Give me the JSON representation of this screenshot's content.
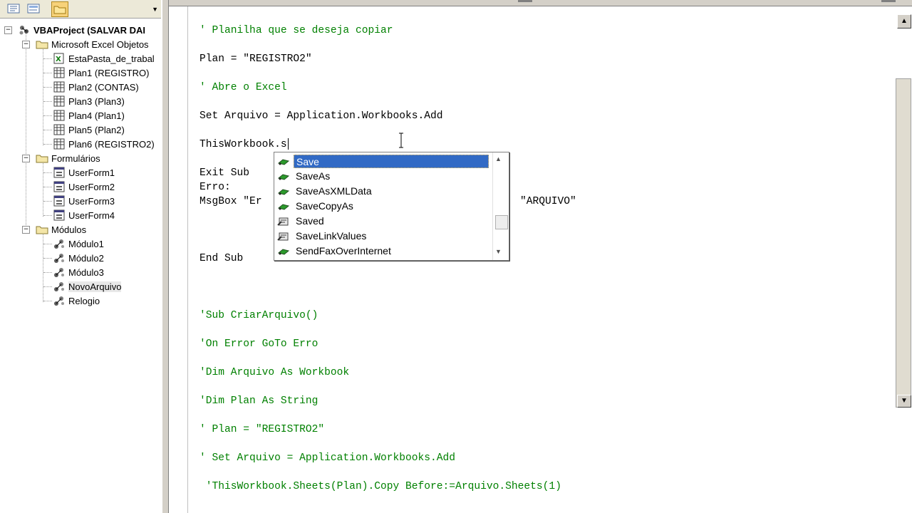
{
  "explorer": {
    "toolbar": {
      "view_code_icon": "view-code-icon",
      "view_object_icon": "view-object-icon",
      "toggle_folders_icon": "folder-icon",
      "dropdown_glyph": "▼"
    },
    "tree": {
      "root": {
        "label": "VBAProject (SALVAR DAI",
        "toggle": "−"
      },
      "groups": [
        {
          "label": "Microsoft Excel Objetos",
          "toggle": "−",
          "items": [
            "EstaPasta_de_trabal",
            "Plan1 (REGISTRO)",
            "Plan2 (CONTAS)",
            "Plan3 (Plan3)",
            "Plan4 (Plan1)",
            "Plan5 (Plan2)",
            "Plan6 (REGISTRO2)"
          ]
        },
        {
          "label": "Formulários",
          "toggle": "−",
          "items": [
            "UserForm1",
            "UserForm2",
            "UserForm3",
            "UserForm4"
          ]
        },
        {
          "label": "Módulos",
          "toggle": "−",
          "items": [
            "Módulo1",
            "Módulo2",
            "Módulo3",
            "NovoArquivo",
            "Relogio"
          ]
        }
      ],
      "selected_item": "NovoArquivo"
    }
  },
  "code": {
    "lines": [
      {
        "text": "' Planilha que se deseja copiar",
        "style": "comment"
      },
      {
        "text": "Plan = \"REGISTRO2\"",
        "style": "code"
      },
      {
        "text": "' Abre o Excel",
        "style": "comment"
      },
      {
        "text": "Set Arquivo = Application.Workbooks.Add",
        "style": "code"
      },
      {
        "text": "ThisWorkbook.s",
        "style": "code"
      },
      {
        "text": "Exit Sub",
        "style": "code"
      },
      {
        "text": "Erro:",
        "style": "code"
      },
      {
        "text": "MsgBox \"Er",
        "style": "code"
      },
      {
        "text": "\"ARQUIVO\"",
        "style": "code"
      },
      {
        "text": "End Sub",
        "style": "code"
      },
      {
        "text": "'Sub CriarArquivo()",
        "style": "comment"
      },
      {
        "text": "'On Error GoTo Erro",
        "style": "comment"
      },
      {
        "text": "'Dim Arquivo As Workbook",
        "style": "comment"
      },
      {
        "text": "'Dim Plan As String",
        "style": "comment"
      },
      {
        "text": "' Plan = \"REGISTRO2\"",
        "style": "comment"
      },
      {
        "text": "' Set Arquivo = Application.Workbooks.Add",
        "style": "comment"
      },
      {
        "text": " 'ThisWorkbook.Sheets(Plan).Copy Before:=Arquivo.Sheets(1)",
        "style": "comment"
      }
    ]
  },
  "intellisense": {
    "items": [
      {
        "label": "Save",
        "icon": "method-icon",
        "selected": true
      },
      {
        "label": "SaveAs",
        "icon": "method-icon",
        "selected": false
      },
      {
        "label": "SaveAsXMLData",
        "icon": "method-icon",
        "selected": false
      },
      {
        "label": "SaveCopyAs",
        "icon": "method-icon",
        "selected": false
      },
      {
        "label": "Saved",
        "icon": "property-icon",
        "selected": false
      },
      {
        "label": "SaveLinkValues",
        "icon": "property-icon",
        "selected": false
      },
      {
        "label": "SendFaxOverInternet",
        "icon": "method-icon",
        "selected": false
      }
    ],
    "scroll_up_glyph": "▲",
    "scroll_down_glyph": "▼"
  },
  "scrollbar": {
    "up_glyph": "▲",
    "down_glyph": "▼"
  },
  "colors": {
    "comment": "#008000",
    "selection": "#316ac5"
  }
}
